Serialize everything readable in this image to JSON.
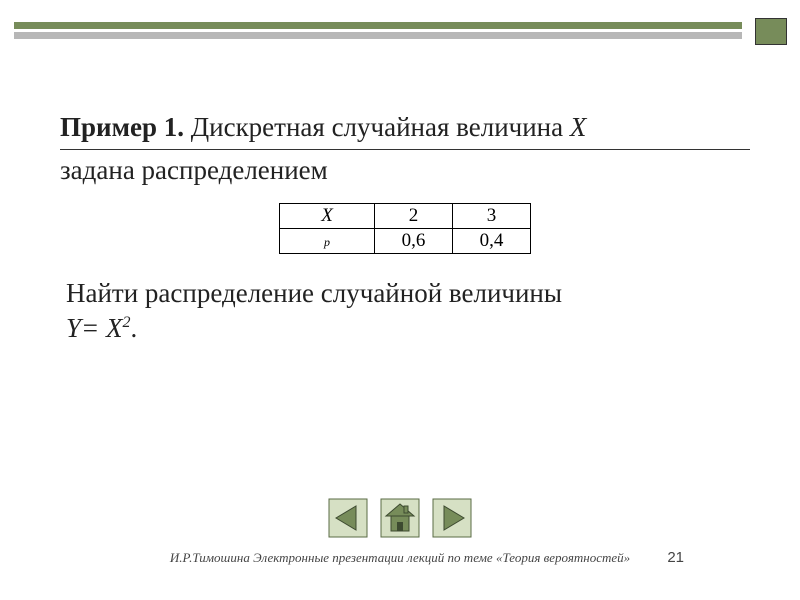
{
  "colors": {
    "accent": "#778c5a",
    "grey": "#b7b7b7"
  },
  "heading": {
    "bold": "Пример 1.",
    "rest_line1": " Дискретная случайная величина ",
    "var": "Х",
    "line2": "задана распределением"
  },
  "table": {
    "row_labels": {
      "x": "X",
      "p": "p"
    },
    "cols": [
      {
        "x": "2",
        "p": "0,6"
      },
      {
        "x": "3",
        "p": "0,4"
      }
    ]
  },
  "task": {
    "prefix": "Найти распределение случайной величины",
    "eq_left": "Y= X",
    "eq_sup": "2",
    "eq_tail": "."
  },
  "nav": {
    "prev": "nav-prev",
    "home": "nav-home",
    "next": "nav-next"
  },
  "footer": "И.Р.Тимошина Электронные презентации лекций по теме «Теория вероятностей»",
  "page_number": "21"
}
